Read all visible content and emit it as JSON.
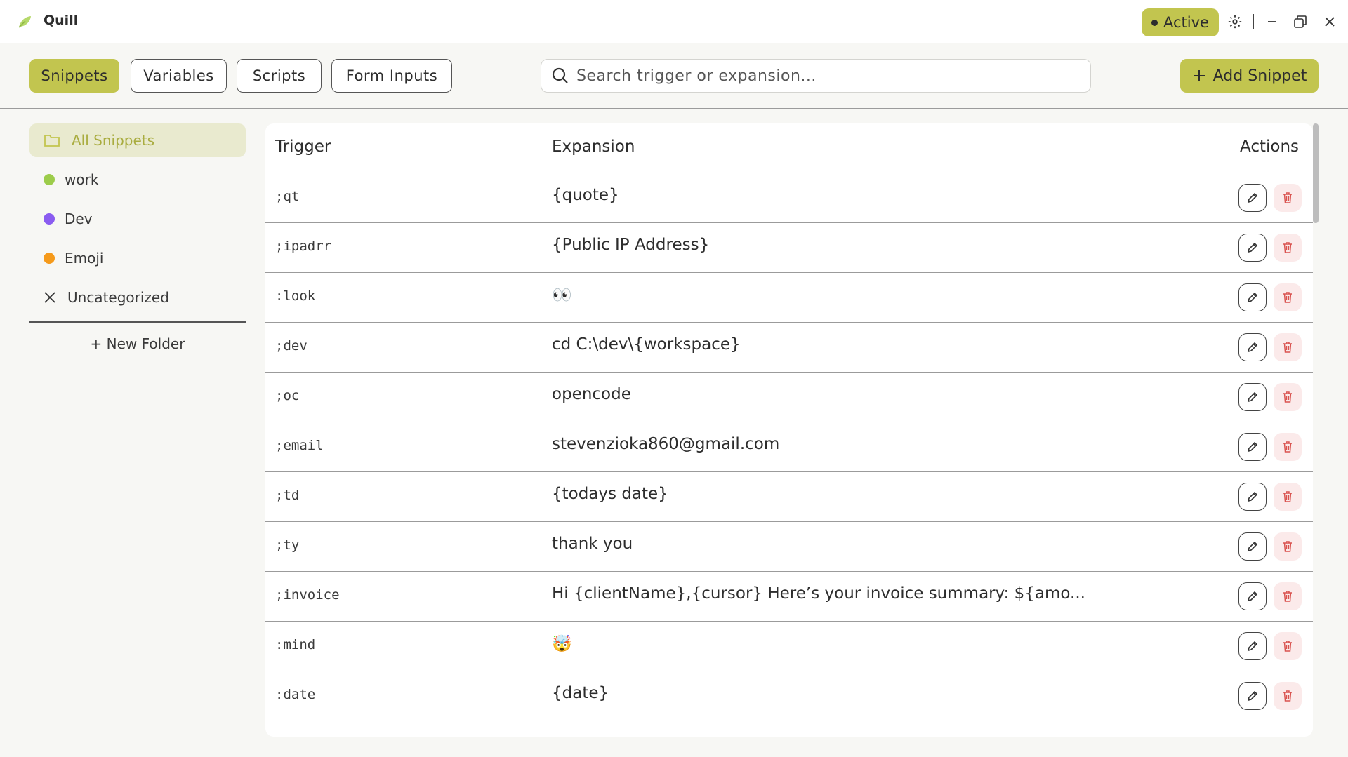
{
  "app": {
    "name": "Quill"
  },
  "titlebar": {
    "status": "Active",
    "icons": [
      "settings-icon",
      "minimize-icon",
      "restore-icon",
      "close-icon"
    ]
  },
  "toolbar": {
    "tabs": [
      {
        "label": "Snippets",
        "active": true
      },
      {
        "label": "Variables",
        "active": false
      },
      {
        "label": "Scripts",
        "active": false
      },
      {
        "label": "Form Inputs",
        "active": false
      }
    ],
    "search": {
      "placeholder": "Search trigger or expansion..."
    },
    "add_label": "Add Snippet"
  },
  "sidebar": {
    "items": [
      {
        "label": "All Snippets",
        "active": true,
        "icon": "folder-icon"
      },
      {
        "label": "work",
        "color": "#9ccc4a"
      },
      {
        "label": "Dev",
        "color": "#8a5cf0"
      },
      {
        "label": "Emoji",
        "color": "#f59a1b"
      },
      {
        "label": "Uncategorized",
        "icon": "x-icon"
      }
    ],
    "new_folder_label": "+ New Folder"
  },
  "table": {
    "headers": {
      "trigger": "Trigger",
      "expansion": "Expansion",
      "actions": "Actions"
    },
    "rows": [
      {
        "trigger": ";qt",
        "expansion": "{quote}"
      },
      {
        "trigger": ";ipadrr",
        "expansion": "{Public IP Address}"
      },
      {
        "trigger": ":look",
        "expansion": "👀"
      },
      {
        "trigger": ";dev",
        "expansion": "cd C:\\dev\\{workspace}"
      },
      {
        "trigger": ";oc",
        "expansion": "opencode"
      },
      {
        "trigger": ";email",
        "expansion": "stevenzioka860@gmail.com"
      },
      {
        "trigger": ";td",
        "expansion": "{todays date}"
      },
      {
        "trigger": ";ty",
        "expansion": "thank you"
      },
      {
        "trigger": ";invoice",
        "expansion": "Hi {clientName},{cursor} Here’s your invoice summary: ${amo..."
      },
      {
        "trigger": ":mind",
        "expansion": "🤯"
      },
      {
        "trigger": ":date",
        "expansion": "{date}"
      }
    ]
  },
  "colors": {
    "accent": "#c2c54f",
    "accent_light": "#e9eacf",
    "delete_bg": "#fbeaea",
    "delete_icon": "#d9534f"
  }
}
